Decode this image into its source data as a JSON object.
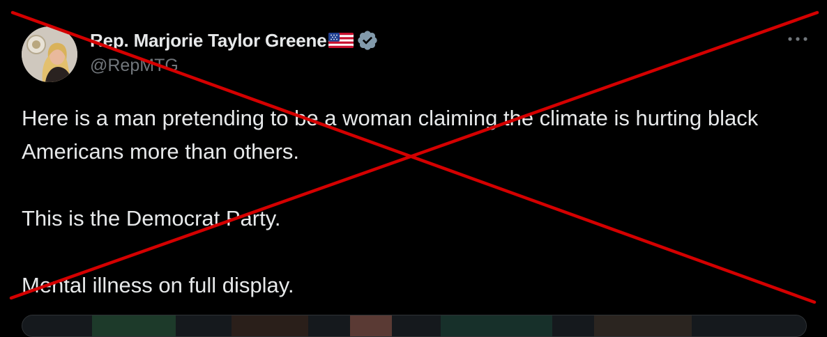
{
  "author": {
    "display_name": "Rep. Marjorie Taylor Greene",
    "handle": "@RepMTG",
    "flag_icon": "us-flag-icon",
    "verified_icon": "verified-badge-icon",
    "verified_color": "#829aab"
  },
  "more_icon": "more-horizontal-icon",
  "tweet": {
    "paragraphs": [
      "Here is a man pretending to be a woman claiming the climate is hurting black Americans more than others.",
      "This is the Democrat Party.",
      "Mental illness on full display."
    ]
  },
  "overlay": {
    "icon": "red-x-cross-icon",
    "color": "#d40000"
  },
  "colors": {
    "background": "#000000",
    "text": "#e7e9ea",
    "secondary_text": "#71767b"
  }
}
